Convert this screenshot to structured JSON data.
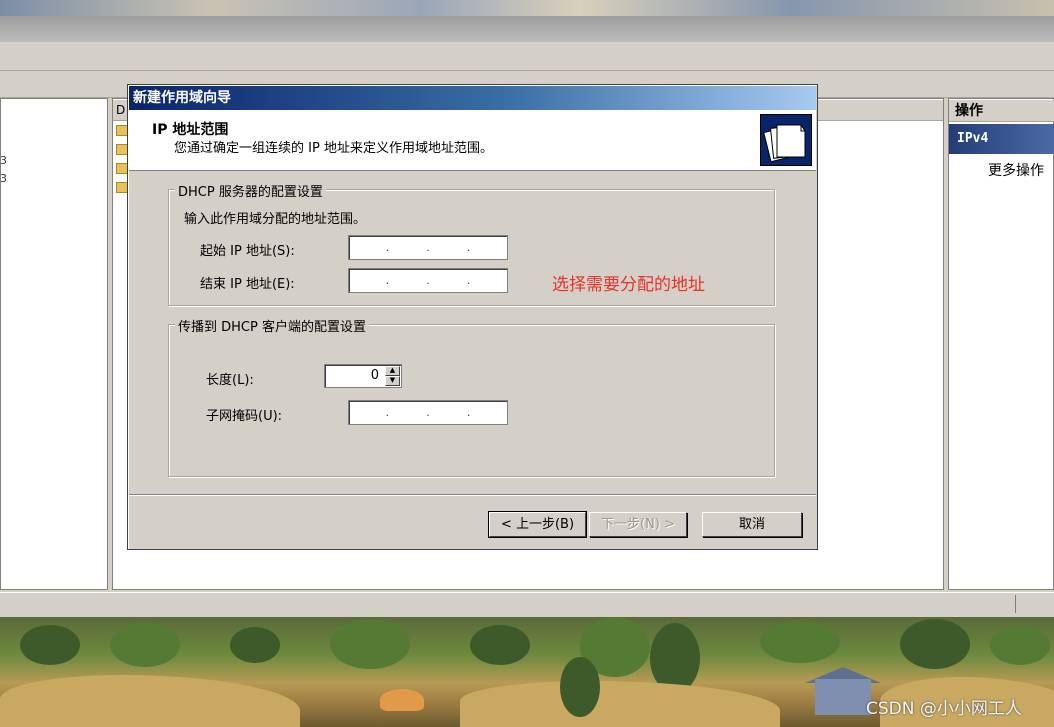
{
  "mmc": {
    "actions_header": "操作",
    "actions_selected": "IPv4",
    "actions_more": "更多操作",
    "center_column_header": "D",
    "left_glyphs": [
      "3",
      "3"
    ]
  },
  "dialog": {
    "title": "新建作用域向导",
    "header": {
      "title": "IP 地址范围",
      "subtitle": "您通过确定一组连续的 IP 地址来定义作用域地址范围。"
    },
    "server_group": {
      "legend": "DHCP 服务器的配置设置",
      "instruction": "输入此作用域分配的地址范围。",
      "start_ip_label": "起始 IP 地址(S):",
      "end_ip_label": "结束 IP 地址(E):",
      "ip_dots": [
        ".",
        ".",
        "."
      ]
    },
    "client_group": {
      "legend": "传播到 DHCP 客户端的配置设置",
      "length_label": "长度(L):",
      "length_value": "0",
      "mask_label": "子网掩码(U):"
    },
    "buttons": {
      "back": "< 上一步(B)",
      "next": "下一步(N) >",
      "cancel": "取消"
    }
  },
  "annotation": "选择需要分配的地址",
  "watermark": "CSDN @小小网工人",
  "colors": {
    "title_gradient_start": "#0a246a",
    "title_gradient_end": "#a6caf0",
    "annotation": "#e8312a",
    "dialog_face": "#d4d0c8"
  }
}
